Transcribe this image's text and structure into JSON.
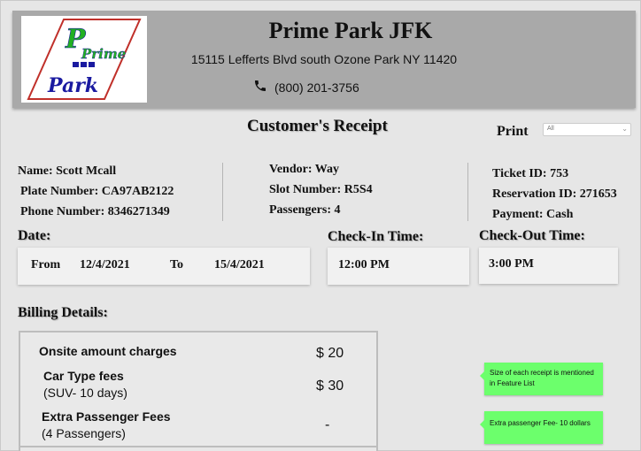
{
  "header": {
    "title": "Prime Park JFK",
    "address": "15115 Lefferts Blvd south Ozone Park NY 11420",
    "phone": "(800) 201-3756",
    "logo": {
      "line1": "Prime",
      "line2": "Park",
      "icon": "phone-icon"
    }
  },
  "receipt": {
    "title": "Customer's Receipt",
    "print_label": "Print",
    "print_select_value": "All"
  },
  "customer": {
    "name": "Name: Scott Mcall",
    "plate": "Plate Number: CA97AB2122",
    "phone": "Phone Number: 8346271349"
  },
  "vendor": {
    "vendor": "Vendor: Way",
    "slot": "Slot Number: R5S4",
    "passengers": "Passengers: 4"
  },
  "ticket": {
    "ticket_id": "Ticket ID: 753",
    "reservation_id": "Reservation ID: 271653",
    "payment": "Payment: Cash"
  },
  "date": {
    "label": "Date:",
    "from_label": "From",
    "from_value": "12/4/2021",
    "to_label": "To",
    "to_value": "15/4/2021"
  },
  "checkin": {
    "label": "Check-In Time:",
    "value": "12:00 PM"
  },
  "checkout": {
    "label": "Check-Out Time:",
    "value": "3:00 PM"
  },
  "billing": {
    "label": "Billing Details:",
    "items": [
      {
        "title": "Onsite amount charges",
        "sub": "",
        "amount": "$ 20"
      },
      {
        "title": "Car Type fees",
        "sub": "(SUV- 10 days)",
        "amount": "$ 30"
      },
      {
        "title": "Extra Passenger Fees",
        "sub": "(4 Passengers)",
        "amount": "-"
      }
    ]
  },
  "notes": [
    "Size of each receipt is mentioned in Feature List",
    "Extra passenger Fee- 10 dollars"
  ],
  "colors": {
    "header_bg": "#a9a9a9",
    "page_bg": "#e6e6e6",
    "note_bg": "#6cff6c",
    "logo_green": "#22b022",
    "logo_blue": "#1a1aa0",
    "logo_red": "#c0302a"
  }
}
